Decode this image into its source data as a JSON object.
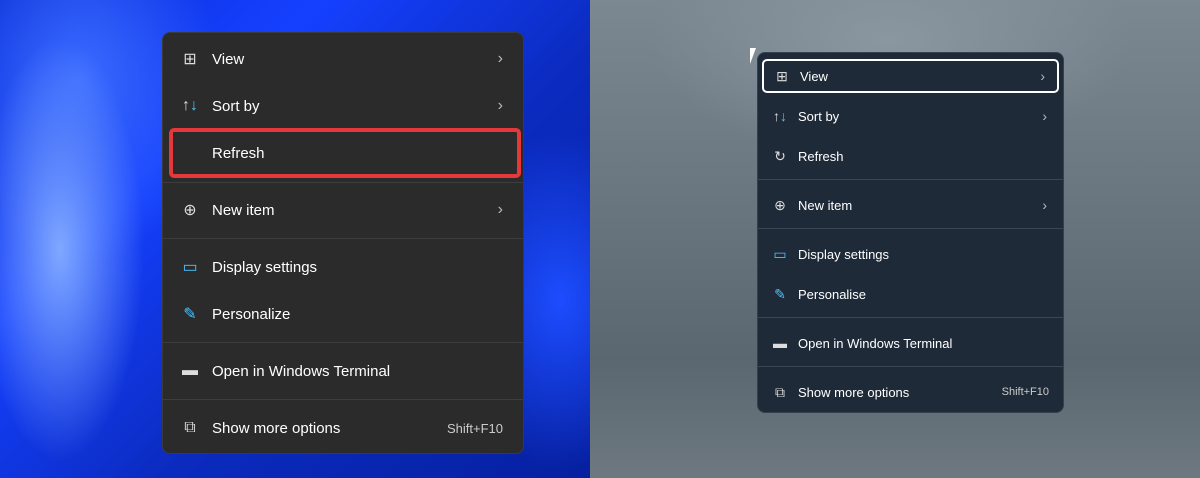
{
  "left_menu": {
    "items": [
      {
        "label": "View",
        "icon": "grid-icon",
        "submenu": true
      },
      {
        "label": "Sort by",
        "icon": "sort-icon",
        "submenu": true
      },
      {
        "label": "Refresh",
        "icon": "none",
        "submenu": false,
        "highlighted": true
      },
      {
        "label": "New item",
        "icon": "plus-circle-icon",
        "submenu": true
      },
      {
        "label": "Display settings",
        "icon": "display-icon"
      },
      {
        "label": "Personalize",
        "icon": "brush-icon"
      },
      {
        "label": "Open in Windows Terminal",
        "icon": "terminal-icon"
      },
      {
        "label": "Show more options",
        "icon": "share-icon",
        "shortcut": "Shift+F10"
      }
    ],
    "highlight_color": "#e5383b"
  },
  "right_menu": {
    "items": [
      {
        "label": "View",
        "icon": "grid-icon",
        "submenu": true,
        "focused": true
      },
      {
        "label": "Sort by",
        "icon": "sort-icon",
        "submenu": true
      },
      {
        "label": "Refresh",
        "icon": "refresh-icon"
      },
      {
        "label": "New item",
        "icon": "plus-circle-icon",
        "submenu": true
      },
      {
        "label": "Display settings",
        "icon": "display-icon"
      },
      {
        "label": "Personalise",
        "icon": "brush-icon"
      },
      {
        "label": "Open in Windows Terminal",
        "icon": "terminal-icon"
      },
      {
        "label": "Show more options",
        "icon": "share-icon",
        "shortcut": "Shift+F10"
      }
    ]
  }
}
